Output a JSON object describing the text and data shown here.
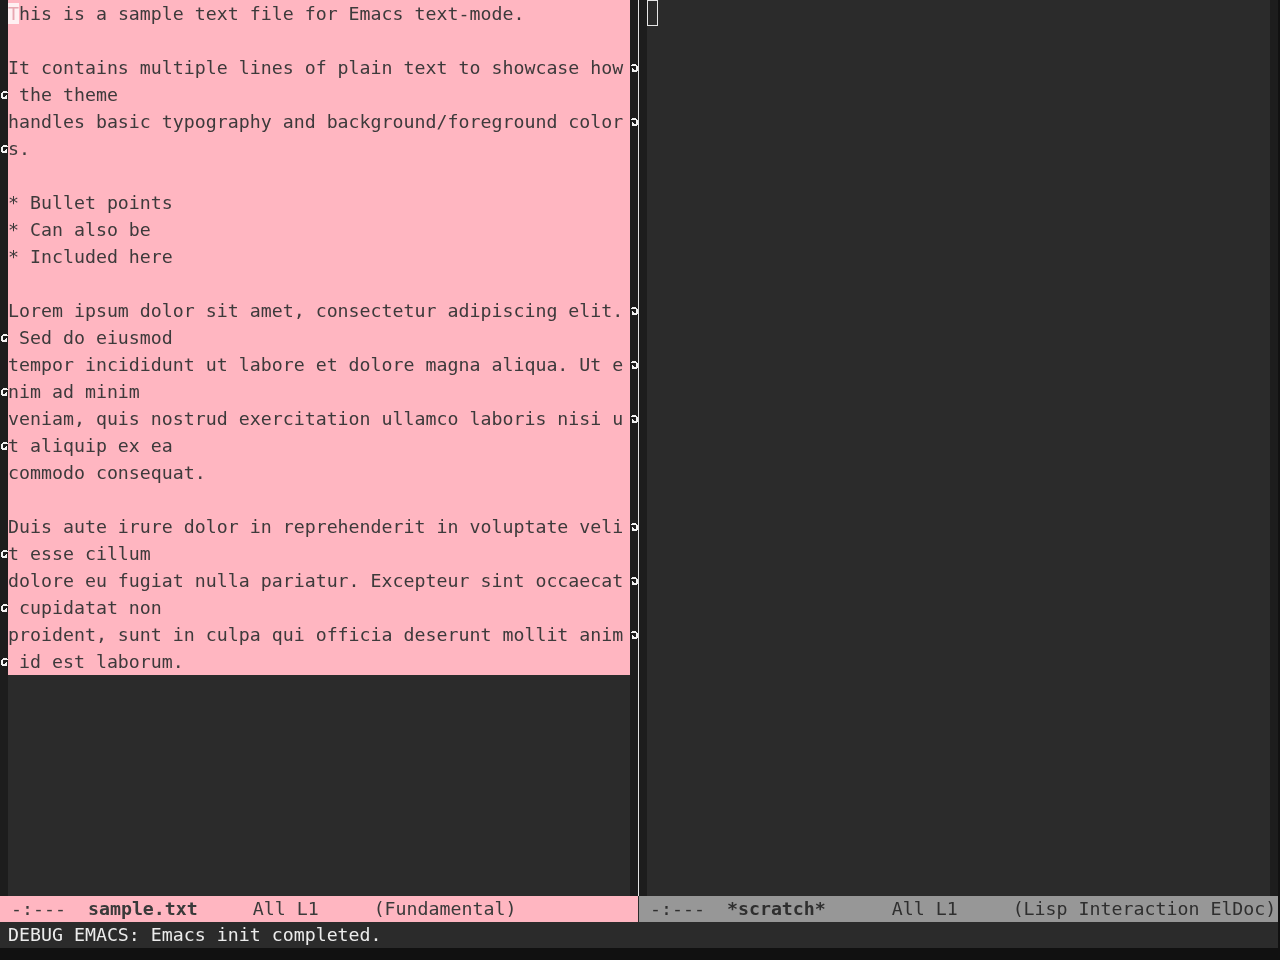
{
  "windows": [
    {
      "selected": true,
      "buffer": {
        "paragraphs": [
          [
            {
              "text": "This is a sample text file for Emacs text-mode.",
              "continued": false
            }
          ],
          [
            {
              "text": "It contains multiple lines of plain text to showcase how",
              "continued": true
            },
            {
              "text": " the theme",
              "continued": false
            },
            {
              "text": "handles basic typography and background/foreground color",
              "continued": true
            },
            {
              "text": "s.",
              "continued": false
            }
          ],
          [
            {
              "text": "* Bullet points",
              "continued": false
            },
            {
              "text": "* Can also be",
              "continued": false
            },
            {
              "text": "* Included here",
              "continued": false
            }
          ],
          [
            {
              "text": "Lorem ipsum dolor sit amet, consectetur adipiscing elit.",
              "continued": true
            },
            {
              "text": " Sed do eiusmod",
              "continued": false
            },
            {
              "text": "tempor incididunt ut labore et dolore magna aliqua. Ut e",
              "continued": true
            },
            {
              "text": "nim ad minim",
              "continued": false
            },
            {
              "text": "veniam, quis nostrud exercitation ullamco laboris nisi u",
              "continued": true
            },
            {
              "text": "t aliquip ex ea",
              "continued": false
            },
            {
              "text": "commodo consequat.",
              "continued": false
            }
          ],
          [
            {
              "text": "Duis aute irure dolor in reprehenderit in voluptate veli",
              "continued": true
            },
            {
              "text": "t esse cillum",
              "continued": false
            },
            {
              "text": "dolore eu fugiat nulla pariatur. Excepteur sint occaecat",
              "continued": true
            },
            {
              "text": " cupidatat non",
              "continued": false
            },
            {
              "text": "proident, sunt in culpa qui officia deserunt mollit anim",
              "continued": true
            },
            {
              "text": " id est laborum.",
              "continued": false
            }
          ]
        ]
      },
      "mode_line": {
        "status": "-:---",
        "buffer_name": "sample.txt",
        "position": "All L1",
        "modes": "(Fundamental)"
      }
    },
    {
      "selected": false,
      "mode_line": {
        "status": "-:---",
        "buffer_name": "*scratch*",
        "position": "All L1",
        "modes": "(Lisp Interaction ElDoc)"
      }
    }
  ],
  "echo_area": {
    "message": "DEBUG EMACS: Emacs init completed."
  }
}
